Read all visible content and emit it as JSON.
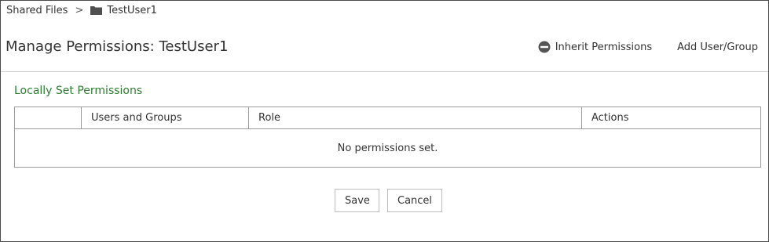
{
  "breadcrumb": {
    "root": "Shared Files",
    "separator": ">",
    "current": "TestUser1",
    "current_icon": "folder-icon"
  },
  "header": {
    "title": "Manage Permissions: TestUser1",
    "inherit_label": "Inherit Permissions",
    "inherit_icon": "minus-circle-icon",
    "add_label": "Add User/Group"
  },
  "section": {
    "title": "Locally Set Permissions",
    "title_color": "#2e7d32"
  },
  "table": {
    "columns": [
      "",
      "Users and Groups",
      "Role",
      "Actions"
    ],
    "empty_message": "No permissions set."
  },
  "footer": {
    "save_label": "Save",
    "cancel_label": "Cancel"
  }
}
